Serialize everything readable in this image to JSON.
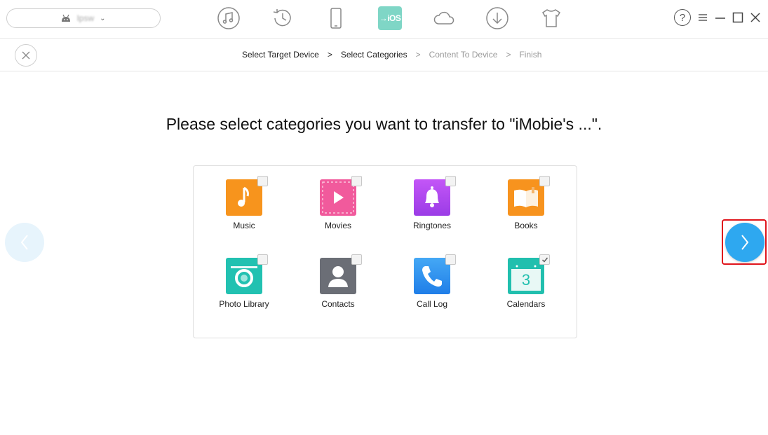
{
  "toolbar": {
    "device_name": "Ipsw",
    "mode_icons": [
      "music-mode-icon",
      "history-icon",
      "phone-icon",
      "ios-mover-icon",
      "cloud-icon",
      "download-icon",
      "tshirt-icon"
    ],
    "active_mode_label": "iOS",
    "help_label": "?"
  },
  "breadcrumb": {
    "steps": [
      "Select Target Device",
      "Select Categories",
      "Content To Device",
      "Finish"
    ],
    "separator": ">",
    "current_index": 1
  },
  "main": {
    "heading": "Please select categories you want to transfer to \"iMobie's ...\"."
  },
  "categories": [
    {
      "label": "Music",
      "checked": false,
      "icon": "music-icon",
      "color": "#f7941d"
    },
    {
      "label": "Movies",
      "checked": false,
      "icon": "movies-icon",
      "color": "#f15a9c"
    },
    {
      "label": "Ringtones",
      "checked": false,
      "icon": "bell-icon",
      "color": "#b04df0"
    },
    {
      "label": "Books",
      "checked": false,
      "icon": "book-icon",
      "color": "#f7931e"
    },
    {
      "label": "Photo Library",
      "checked": false,
      "icon": "camera-icon",
      "color": "#22c1b1"
    },
    {
      "label": "Contacts",
      "checked": false,
      "icon": "contact-icon",
      "color": "#6b6e76"
    },
    {
      "label": "Call Log",
      "checked": false,
      "icon": "phone-call-icon",
      "color": "#2a8ff0"
    },
    {
      "label": "Calendars",
      "checked": true,
      "icon": "calendar-icon",
      "color": "#21bfae",
      "day": "3"
    }
  ],
  "colors": {
    "accent": "#2ea8f0",
    "highlight_frame": "#e0151c"
  }
}
